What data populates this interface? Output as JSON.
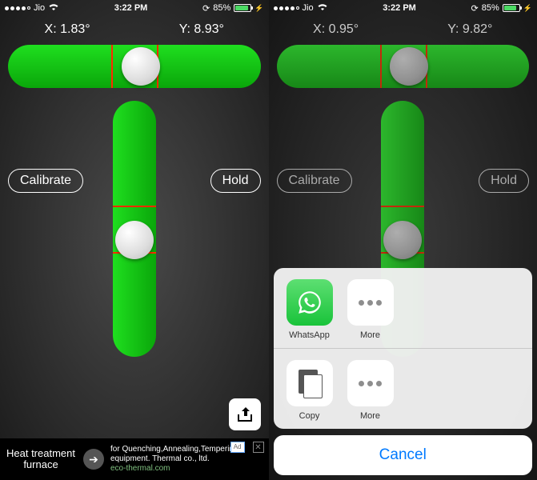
{
  "left": {
    "status": {
      "carrier": "Jio",
      "time": "3:22 PM",
      "battery": "85%"
    },
    "readings": {
      "x": "X: 1.83°",
      "y": "Y: 8.93°"
    },
    "buttons": {
      "calibrate": "Calibrate",
      "hold": "Hold"
    },
    "ad": {
      "title": "Heat treatment furnace",
      "text": "for Quenching,Annealing,Tempering equipment. Thermal co., ltd.",
      "link": "eco-thermal.com",
      "chip": "Ad"
    }
  },
  "right": {
    "status": {
      "carrier": "Jio",
      "time": "3:22 PM",
      "battery": "85%"
    },
    "readings": {
      "x": "X: 0.95°",
      "y": "Y: 9.82°"
    },
    "buttons": {
      "calibrate": "Calibrate",
      "hold": "Hold"
    },
    "sheet": {
      "apps": {
        "whatsapp": "WhatsApp",
        "more": "More"
      },
      "actions": {
        "copy": "Copy",
        "more": "More"
      },
      "cancel": "Cancel"
    }
  }
}
